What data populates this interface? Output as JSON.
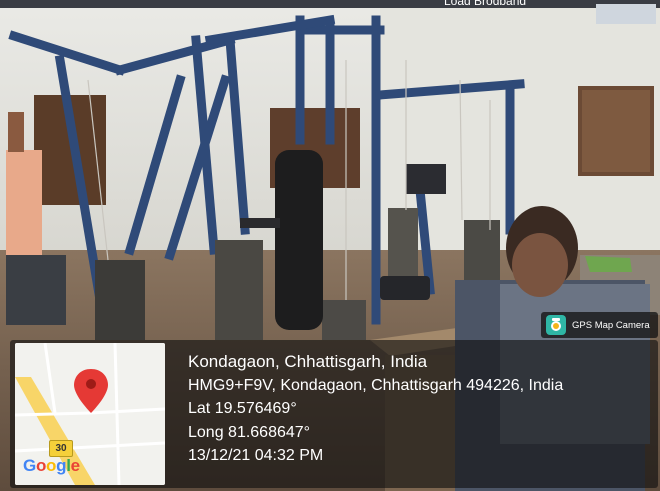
{
  "gps_badge": {
    "label": "GPS Map Camera",
    "icon": "gps-camera-icon"
  },
  "location": {
    "title": "Kondagaon, Chhattisgarh, India",
    "address": "HMG9+F9V, Kondagaon, Chhattisgarh 494226, India",
    "latitude": "Lat 19.576469°",
    "longitude": "Long 81.668647°",
    "timestamp": "13/12/21 04:32 PM"
  },
  "map": {
    "road_shield": "30",
    "logo": "Google",
    "pin_icon": "map-pin-icon",
    "colors": {
      "pin": "#e53935",
      "road_major": "#f8d568",
      "road_minor": "#ffffff",
      "background": "#f2f2ee"
    }
  },
  "top_caption": "Load Brodband"
}
